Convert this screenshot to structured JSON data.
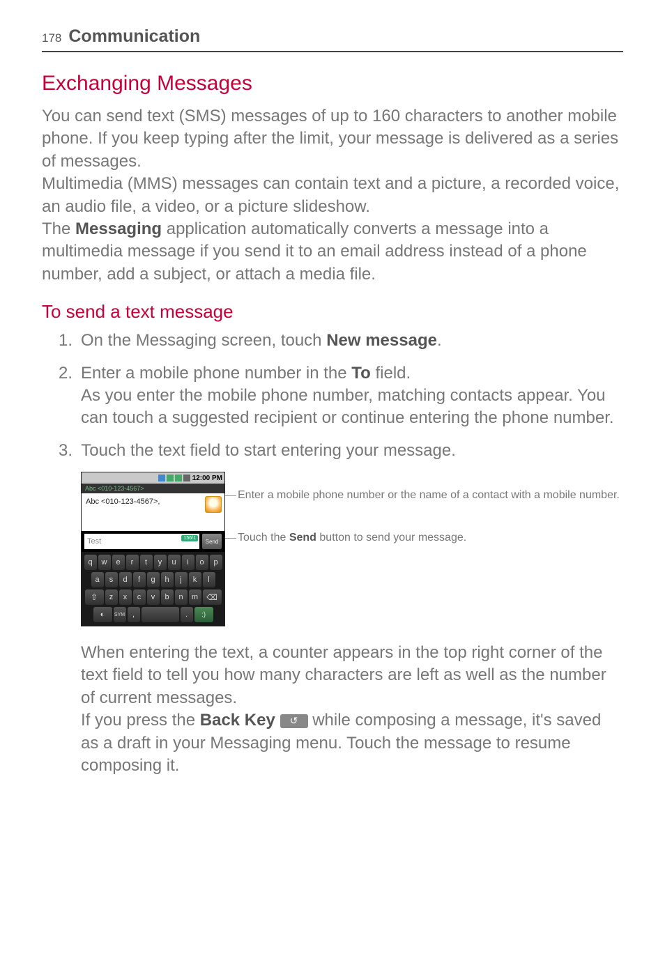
{
  "header": {
    "page_number": "178",
    "title": "Communication"
  },
  "section": {
    "h1": "Exchanging Messages",
    "intro_parts": {
      "p1": "You can send text (SMS) messages of up to 160 characters to another mobile phone. If you keep typing after the limit, your message is delivered as a series of messages.",
      "p2": "Multimedia (MMS) messages can contain text and a picture, a recorded voice, an audio file, a video, or a picture slideshow.",
      "p3a": "The ",
      "p3_bold": "Messaging",
      "p3b": " application automatically converts a message into a multimedia message if you send it to an email address instead of a phone number, add a subject, or attach a media file."
    },
    "h2": "To send a text message",
    "steps": {
      "s1": {
        "num": "1.",
        "a": "On the Messaging screen, touch ",
        "bold": "New message",
        "b": "."
      },
      "s2": {
        "num": "2.",
        "a": "Enter a mobile phone number in the ",
        "bold": "To",
        "b": " field.",
        "c": "As you enter the mobile phone number, matching contacts appear. You can touch a suggested recipient or continue entering the phone number."
      },
      "s3": {
        "num": "3.",
        "a": "Touch the text field to start entering your message."
      }
    }
  },
  "figure": {
    "status_time": "12:00 PM",
    "recipient_hint": "Abc <010-123-4567>",
    "to_value": "Abc <010-123-4567>,",
    "msg_placeholder": "Test",
    "counter": "156/1",
    "send_label": "Send",
    "keys": {
      "r1": [
        "q",
        "w",
        "e",
        "r",
        "t",
        "y",
        "u",
        "i",
        "o",
        "p"
      ],
      "r2": [
        "a",
        "s",
        "d",
        "f",
        "g",
        "h",
        "j",
        "k",
        "l"
      ],
      "r3_shift": "⇧",
      "r3": [
        "z",
        "x",
        "c",
        "v",
        "b",
        "n",
        "m"
      ],
      "r3_del": "⌫",
      "r4_mode": "◐",
      "r4_sym": "SYM",
      "r4_comma": ",",
      "r4_space": " ",
      "r4_dot": ".",
      "r4_smile": ":)"
    },
    "callouts": {
      "c1": "Enter a mobile phone number or the name of a contact with a mobile number.",
      "c2a": "Touch the ",
      "c2_bold": "Send",
      "c2b": " button to send your message."
    }
  },
  "after_fig": {
    "p1": "When entering the text, a counter appears in the top right corner of the text field to tell you how many characters are left as well as the number of current messages.",
    "p2a": "If you press the ",
    "p2_bold": "Back Key",
    "p2b": " while composing a message, it's saved as a draft in your Messaging menu. Touch the message to resume composing it."
  }
}
